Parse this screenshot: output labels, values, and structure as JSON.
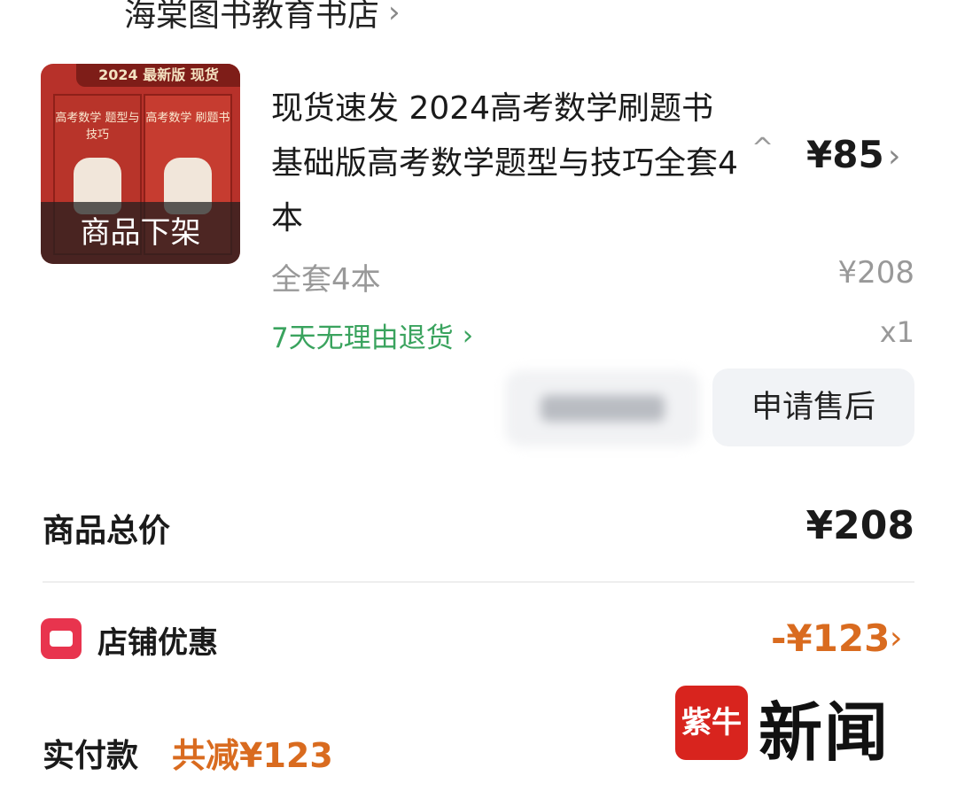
{
  "shop": {
    "name": "海棠图书教育书店",
    "chevron": "›"
  },
  "product": {
    "thumb_banner": "2024 最新版 现货",
    "book1_title": "高考数学 题型与技巧",
    "book2_title": "高考数学 刷题书",
    "status_overlay": "商品下架",
    "title": "现货速发 2024高考数学刷题书基础版高考数学题型与技巧全套4本",
    "collapse": "^",
    "price": "¥85",
    "price_chevron": "›",
    "spec": "全套4本",
    "original_price": "¥208",
    "return_policy": "7天无理由退货",
    "return_chevron": "›",
    "quantity": "x1"
  },
  "actions": {
    "after_sale_label": "申请售后"
  },
  "summary": {
    "total_label": "商品总价",
    "total_value": "¥208",
    "coupon_label": "店铺优惠",
    "coupon_value": "-¥123",
    "coupon_chevron": "›",
    "pay_label": "实付款",
    "pay_discount": "共减¥123"
  },
  "watermark": {
    "badge": "紫牛",
    "text": "新闻"
  },
  "colors": {
    "green": "#3aa35e",
    "orange": "#d96b1f",
    "red": "#e8344e"
  }
}
